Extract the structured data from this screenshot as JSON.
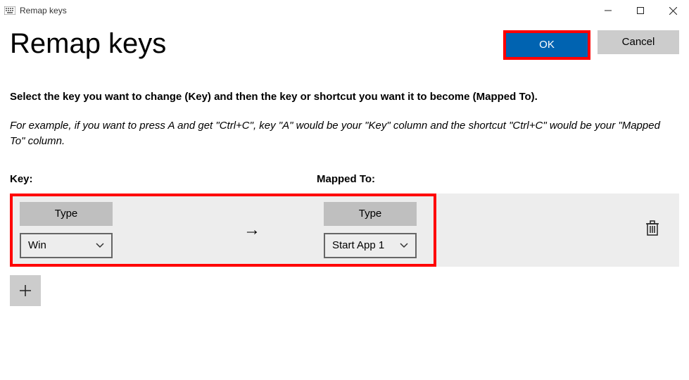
{
  "window": {
    "title": "Remap keys"
  },
  "page": {
    "heading": "Remap keys",
    "instruction": "Select the key you want to change (Key) and then the key or shortcut you want it to become (Mapped To).",
    "example": "For example, if you want to press A and get \"Ctrl+C\", key \"A\" would be your \"Key\" column and the shortcut \"Ctrl+C\" would be your \"Mapped To\" column."
  },
  "buttons": {
    "ok": "OK",
    "cancel": "Cancel"
  },
  "columns": {
    "key": "Key:",
    "mapped": "Mapped To:"
  },
  "row": {
    "type_label": "Type",
    "key_value": "Win",
    "mapped_value": "Start App 1"
  },
  "icons": {
    "arrow": "→",
    "chevron": "⌄",
    "add": "+"
  }
}
